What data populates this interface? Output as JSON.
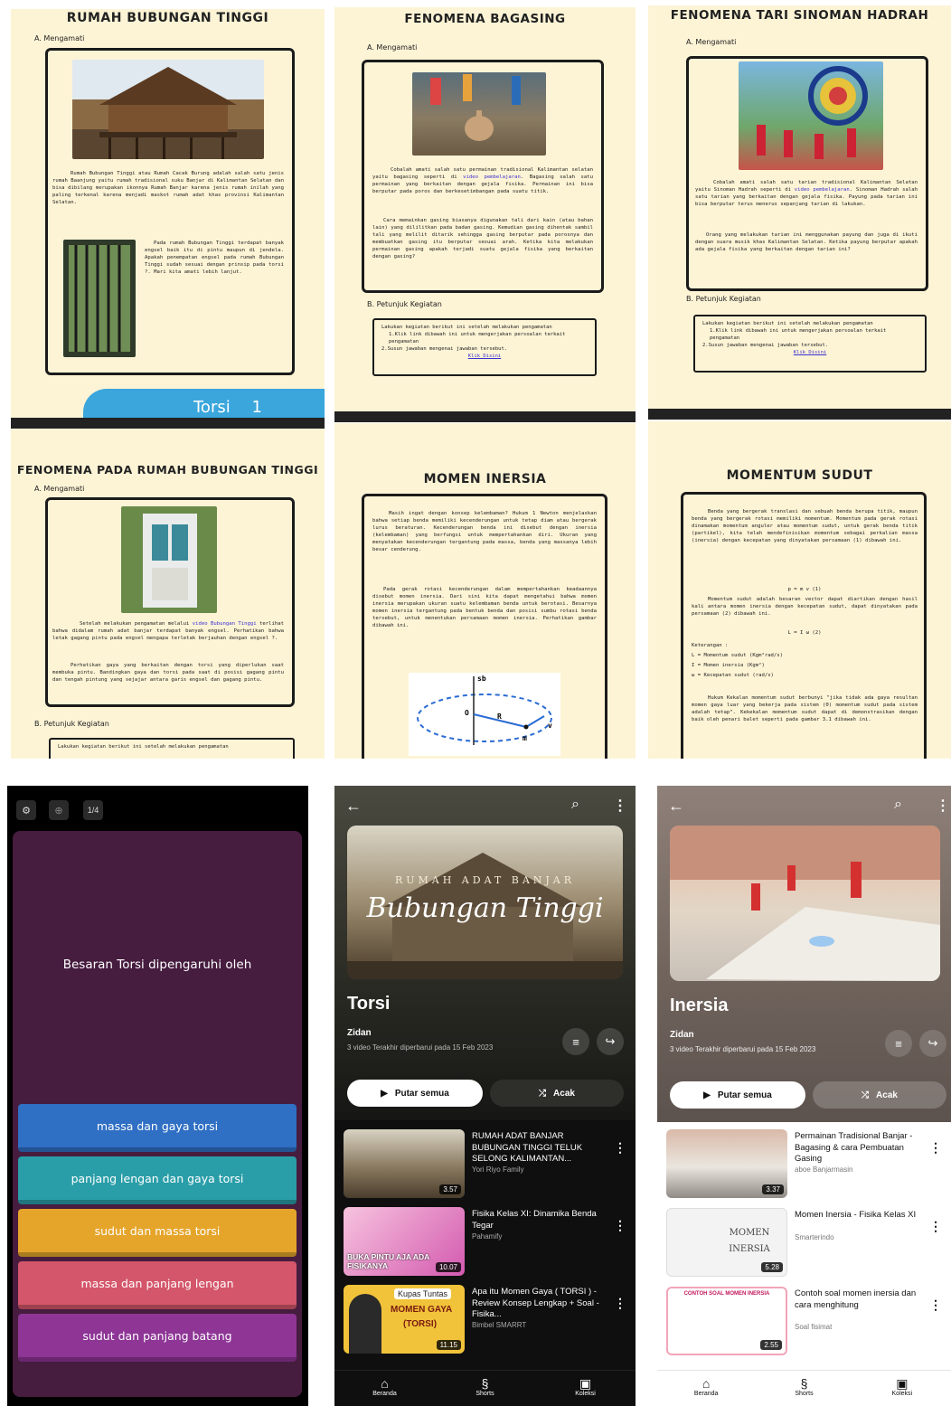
{
  "panels": {
    "p1": {
      "title": "RUMAH BUBUNGAN TINGGI",
      "section": "A. Mengamati",
      "paragraph": "Rumah Bubungan Tinggi atau Rumah Cacak Burung adalah salah satu jenis rumah Baanjung yaitu rumah tradisional suku Banjar di Kalimantan Selatan dan bisa dibilang merupakan ikonnya Rumah Banjar karena jenis rumah inilah yang paling terkenal karena menjadi maskot rumah adat khas provinsi Kalimantan Selatan.",
      "paragraph2": "Pada rumah Bubungan Tinggi terdapat banyak engsel baik itu di pintu maupun di jendela. Apakah penempatan engsel pada rumah Bubungan Tinggi sudah sesuai dengan prinsip pada torsi ?. Mari kita amati lebih lanjut.",
      "banner": "Torsi",
      "banner_num": "1"
    },
    "p2": {
      "title": "FENOMENA BAGASING",
      "section": "A. Mengamati",
      "para_a": "Cobalah amati salah satu permainan tradisional Kalimantan selatan yaitu bagasing seperti di",
      "link_a": "video pembelajaran",
      "para_b": ". Bagasing salah satu permainan yang berkaitan dengan gejala fisika. Permainan ini bisa berputar pada poros dan berkesetimbangan pada suatu titik.",
      "paragraph2": "Cara memainkan gasing biasanya digunakan tali dari kain (atau bahan lain) yang dililitkan pada badan gasing. Kemudian gasing dihentak sambil tali yang melilit ditarik sehingga gasing berputar pada porosnya dan membuatkan gasing itu berputar sesuai arah. Ketika kita melakukan permainan gasing apakah terjadi suatu gejala fisika yang berkaitan dengan gasing?",
      "section_b": "B. Petunjuk Kegiatan",
      "box_intro": "Lakukan kegiatan berikut ini setelah melakukan pengamatan",
      "box_1": "1.Klik link dibawah ini untuk mengerjakan persoalan terkait pengamatan",
      "box_2": "2.Susun jawaban mengenai jawaban tersebut.",
      "box_link": "Klik Disini"
    },
    "p3": {
      "title": "FENOMENA TARI SINOMAN HADRAH",
      "section": "A. Mengamati",
      "para_a": "Cobalah amati salah satu tarian tradisional Kalimantan Selatan yaitu Sinoman Hadrah seperti di",
      "link_a": "video pembelajaran",
      "para_b": ". Sinoman Hadrah salah satu tarian yang berkaitan dengan gejala fisika. Payung pada tarian ini bisa berputar terus menerus sepanjang tarian di lakukan.",
      "paragraph2": "Orang yang melakukan tarian ini menggunakan payung dan juga di ikuti dengan suara musik khas Kalimantan Selatan. Ketika payung berputar apakah ada gejala fisika yang berkaitan dengan tarian ini?",
      "section_b": "B. Petunjuk Kegiatan",
      "box_intro": "Lakukan kegiatan berikut ini setelah melakukan pengamatan",
      "box_1": "1.Klik link dibawah ini untuk mengerjakan persoalan terkait pengamatan",
      "box_2": "2.Susun jawaban mengenai jawaban tersebut.",
      "box_link": "Klik Disini"
    },
    "p4": {
      "title": "FENOMENA PADA RUMAH BUBUNGAN TINGGI",
      "section": "A. Mengamati",
      "para_a": "Setelah melakukan pengamatan melalui",
      "link_a": "video Bubungan Tinggi",
      "para_b": "terlihat bahwa didalam rumah adat banjar terdapat banyak engsel. Perhatikan bahwa letak gagang pintu pada engsel mengapa terletak berjauhan dengan engsel ?.",
      "paragraph2": "Perhatikan gaya yang berkaitan dengan torsi yang diperlukan saat membuka pintu. Bandingkan gaya dan torsi pada saat di posisi gagang pintu dan tengah pintung yang sejajar antara garis engsel dan gagang pintu.",
      "section_b": "B. Petunjuk Kegiatan",
      "box_intro": "Lakukan kegiatan berikut ini setelah melakukan pengamatan"
    },
    "p5": {
      "title": "MOMEN INERSIA",
      "paragraph": "Masih ingat dengan konsep kelembaman? Hukum 1 Newton menjelaskan bahwa setiap benda memiliki kecenderungan untuk tetap diam atau bergerak lurus beraturan. Kecenderungan benda ini disebut dengan inersia (kelembaman) yang berfungsi untuk mempertahankan diri. Ukuran yang menyatakan kecenderungan tergantung pada massa, benda yang massanya lebih besar cenderung.",
      "paragraph2": "Pada gerak rotasi kecenderungan dalam mempertahankan keadaannya disebut momen inersia. Dari sini kita dapat mengetahui bahwa momen inersia merupakan ukuran suatu kelembaman benda untuk berotasi. Besarnya momen inersia tergantung pada bentuk benda dan posisi sumbu rotasi benda tersebut, untuk menentukan persamaan momen inersia. Perhatikan gambar dibawah ini.",
      "fig_labels": [
        "sb",
        "O",
        "R",
        "v",
        "m"
      ]
    },
    "p6": {
      "title": "MOMENTUM SUDUT",
      "paragraph": "Benda yang bergerak translasi dan sebuah benda berupa titik, maupun benda yang bergerak rotasi memiliki momentum. Momentum pada gerak rotasi dinamakan momentum anguler atau momentum sudut, untuk gerak benda titik (partikel), kita telah mendefinisikan momentum sebagai perkalian massa (inersia) dengan kecepatan yang dinyatakan persamaan (1) dibawah ini.",
      "eq1": "p = m v  (1)",
      "paragraph2": "Momentum sudut adalah besaran vector dapat diartikan dengan hasil kali antara momen inersia dengan kecepatan sudut, dapat dinyatakan pada persamaan (2) dibawah ini.",
      "eq2": "L = I ω  (2)",
      "ket": "Keterangan :",
      "ket1": "L = Momentum sudut (Kgm²rad/s)",
      "ket2": "I = Momen inersia (Kgm²)",
      "ket3": "ω = Kecepatan sudut (rad/s)",
      "paragraph3": "Hukum Kekalan momentum sudut berbunyi \"jika tidak ada gaya resultan momen gaya luar yang bekerja pada sistem (0) momentum sudut pada sistem adalah tetap\". Kekekalan momentum sudut dapat di demonstrasikan dengan baik oleh penari balet seperti pada gambar 3.1 dibawah ini."
    },
    "quiz": {
      "page_counter": "1/4",
      "question": "Besaran Torsi dipengaruhi oleh",
      "answers": [
        {
          "label": "massa dan gaya torsi",
          "color": "#2f6fc4"
        },
        {
          "label": "panjang lengan dan gaya torsi",
          "color": "#2a9ea8"
        },
        {
          "label": "sudut dan massa torsi",
          "color": "#e5a52b"
        },
        {
          "label": "massa dan panjang lengan",
          "color": "#d4566a"
        },
        {
          "label": "sudut dan panjang batang",
          "color": "#8e3596"
        }
      ],
      "bg_color": "#461c3f"
    },
    "yt1": {
      "hero_text1": "RUMAH ADAT BANJAR",
      "hero_text2": "Bubungan Tinggi",
      "title": "Torsi",
      "owner": "Zidan",
      "meta": "3 video   Terakhir diperbarui pada 15 Feb 2023",
      "play_all": "Putar semua",
      "shuffle": "Acak",
      "videos": [
        {
          "title": "RUMAH ADAT BANJAR BUBUNGAN TINGGI TELUK SELONG KALIMANTAN...",
          "channel": "Yori Riyo Family",
          "duration": "3.57"
        },
        {
          "title": "Fisika Kelas XI: Dinamika Benda Tegar",
          "channel": "Pahamify",
          "duration": "10.07",
          "thumb_text": "BUKA PINTU AJA ADA FISIKANYA"
        },
        {
          "title": "Apa itu Momen Gaya ( TORSI ) - Review Konsep Lengkap + Soal - Fisika...",
          "channel": "Bimbel SMARRT",
          "duration": "11.15",
          "thumb_text1": "Kupas Tuntas",
          "thumb_text2": "MOMEN GAYA",
          "thumb_text3": "(TORSI)"
        }
      ],
      "nav": [
        "Beranda",
        "Shorts",
        "Koleksi"
      ]
    },
    "yt2": {
      "title": "Inersia",
      "owner": "Zidan",
      "meta": "3 video   Terakhir diperbarui pada 15 Feb 2023",
      "play_all": "Putar semua",
      "shuffle": "Acak",
      "videos": [
        {
          "title": "Permainan Tradisional Banjar - Bagasing & cara Pembuatan Gasing",
          "channel": "aboe Banjarmasin",
          "duration": "3.37"
        },
        {
          "title": "Momen Inersia - Fisika Kelas XI",
          "channel": "Smarterindo",
          "duration": "5.28",
          "thumb_text": "MOMEN INERSIA"
        },
        {
          "title": "Contoh soal momen inersia dan cara menghitung",
          "channel": "Soal fisimat",
          "duration": "2.55",
          "thumb_text": "CONTOH SOAL MOMEN INERSIA"
        }
      ],
      "nav": [
        "Beranda",
        "Shorts",
        "Koleksi"
      ]
    }
  }
}
